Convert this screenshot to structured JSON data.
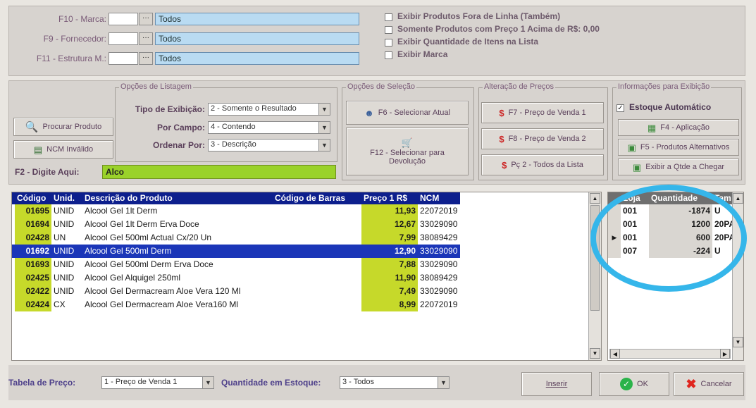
{
  "filters": {
    "marca": {
      "label": "F10 - Marca:",
      "value": "Todos"
    },
    "fornecedor": {
      "label": "F9 - Fornecedor:",
      "value": "Todos"
    },
    "estrutura": {
      "label": "F11 - Estrutura M.:",
      "value": "Todos"
    },
    "ellipsis": "···"
  },
  "checkboxes": [
    {
      "label": "Exibir Produtos Fora de Linha (Também)",
      "checked": false
    },
    {
      "label": "Somente Produtos com Preço 1 Acima de R$: 0,00",
      "checked": false
    },
    {
      "label": "Exibir Quantidade de Itens na Lista",
      "checked": false
    },
    {
      "label": "Exibir Marca",
      "checked": false
    }
  ],
  "listing": {
    "title": "Opções de Listagem",
    "tipo_label": "Tipo de Exibição:",
    "tipo_value": "2 - Somente o Resultado",
    "campo_label": "Por Campo:",
    "campo_value": "4 - Contendo",
    "ordenar_label": "Ordenar Por:",
    "ordenar_value": "3 - Descrição"
  },
  "left_buttons": {
    "procurar": "Procurar Produto",
    "ncm": "NCM Inválido"
  },
  "search": {
    "label": "F2 - Digite Aqui:",
    "value": "Alco"
  },
  "selection": {
    "title": "Opções de Seleção",
    "f6": "F6 - Selecionar Atual",
    "f12": "F12 - Selecionar para Devolução"
  },
  "prices": {
    "title": "Alteração de Preços",
    "f7": "F7 - Preço de Venda 1",
    "f8": "F8 - Preço de Venda 2",
    "pc2": "Pç 2 - Todos da Lista"
  },
  "info": {
    "title": "Informações para Exibição",
    "estoque": "Estoque Automático",
    "f4": "F4 - Aplicação",
    "f5": "F5 - Produtos Alternativos",
    "qtde": "Exibir a Qtde a Chegar"
  },
  "products": {
    "headers": [
      "Código",
      "Unid.",
      "Descrição do Produto",
      "Código de Barras",
      "Preço 1 R$",
      "NCM"
    ],
    "rows": [
      {
        "code": "01695",
        "unit": "UNID",
        "desc": "Alcool Gel 1lt Derm",
        "barcode": "",
        "price": "11,93",
        "ncm": "22072019"
      },
      {
        "code": "01694",
        "unit": "UNID",
        "desc": "Alcool Gel 1lt Derm Erva Doce",
        "barcode": "",
        "price": "12,67",
        "ncm": "33029090"
      },
      {
        "code": "02428",
        "unit": "UN",
        "desc": "Alcool Gel 500ml Actual Cx/20 Un",
        "barcode": "",
        "price": "7,99",
        "ncm": "38089429"
      },
      {
        "code": "01692",
        "unit": "UNID",
        "desc": "Alcool Gel 500ml Derm",
        "barcode": "",
        "price": "12,90",
        "ncm": "33029090",
        "selected": true
      },
      {
        "code": "01693",
        "unit": "UNID",
        "desc": "Alcool Gel 500ml Derm Erva Doce",
        "barcode": "",
        "price": "7,88",
        "ncm": "33029090"
      },
      {
        "code": "02425",
        "unit": "UNID",
        "desc": "Alcool Gel Alquigel 250ml",
        "barcode": "",
        "price": "11,90",
        "ncm": "38089429"
      },
      {
        "code": "02422",
        "unit": "UNID",
        "desc": "Alcool Gel Dermacream Aloe Vera 120 Ml",
        "barcode": "",
        "price": "7,49",
        "ncm": "33029090"
      },
      {
        "code": "02424",
        "unit": "CX",
        "desc": "Alcool Gel Dermacream Aloe Vera160 Ml",
        "barcode": "",
        "price": "8,99",
        "ncm": "22072019"
      }
    ]
  },
  "stock": {
    "headers": [
      "Loja",
      "Quantidade",
      "Tam"
    ],
    "rows": [
      {
        "loja": "001",
        "qty": "-1874",
        "tam": "U"
      },
      {
        "loja": "001",
        "qty": "1200",
        "tam": "20PA"
      },
      {
        "loja": "001",
        "qty": "600",
        "tam": "20PA",
        "current": true
      },
      {
        "loja": "007",
        "qty": "-224",
        "tam": "U"
      }
    ]
  },
  "bottom": {
    "tabela_label": "Tabela de Preço:",
    "tabela_value": "1 - Preço de Venda 1",
    "qtd_label": "Quantidade em Estoque:",
    "qtd_value": "3 - Todos",
    "inserir": "Inserir",
    "ok": "OK",
    "cancelar": "Cancelar"
  },
  "colors": {
    "header_blue": "#0d1f8d",
    "code_green": "#c6d92a",
    "selected_row": "#1b36b8",
    "annotation": "#35b6ea"
  }
}
